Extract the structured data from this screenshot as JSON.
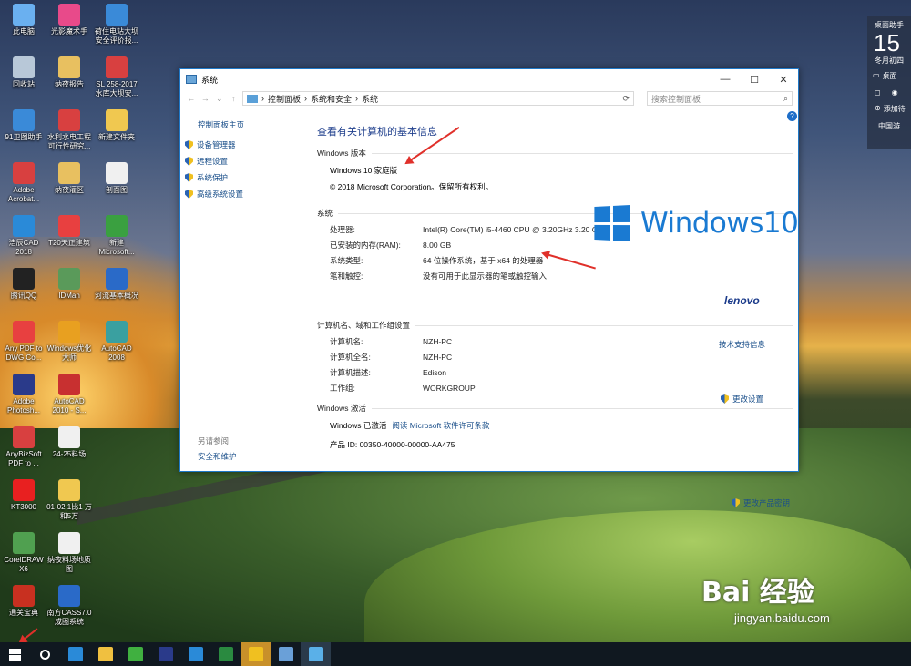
{
  "desktop_icons": [
    {
      "label": "此电脑",
      "color": "#6ab0f0"
    },
    {
      "label": "光影魔术手",
      "color": "#e84a8a"
    },
    {
      "label": "荷住电站大坝安全评价报...",
      "color": "#3a8ad8"
    },
    {
      "label": "回收站",
      "color": "#b8c8d8"
    },
    {
      "label": "纳夜报告",
      "color": "#e8c060"
    },
    {
      "label": "SL 258-2017 水库大坝安...",
      "color": "#d84040"
    },
    {
      "label": "91卫图助手",
      "color": "#3a8ad8"
    },
    {
      "label": "水利水电工程可行性研究...",
      "color": "#d84040"
    },
    {
      "label": "新建文件夹",
      "color": "#f0c850"
    },
    {
      "label": "Adobe Acrobat...",
      "color": "#d84040"
    },
    {
      "label": "纳夜灌区",
      "color": "#e8c060"
    },
    {
      "label": "剖面图",
      "color": "#f0f0f0"
    },
    {
      "label": "浩辰CAD 2018",
      "color": "#2a8ad8"
    },
    {
      "label": "T20天正建筑",
      "color": "#e84040"
    },
    {
      "label": "新建 Microsoft...",
      "color": "#3aa040"
    },
    {
      "label": "腾讯QQ",
      "color": "#222"
    },
    {
      "label": "IDMan",
      "color": "#5a9a5a"
    },
    {
      "label": "河流基本概况",
      "color": "#2a6ac8"
    },
    {
      "label": "Any PDF to DWG Co...",
      "color": "#e84040"
    },
    {
      "label": "Windows优化大师",
      "color": "#e8a020"
    },
    {
      "label": "AutoCAD 2008",
      "color": "#3aa0a0"
    },
    {
      "label": "Adobe Photosh...",
      "color": "#2a3a8a"
    },
    {
      "label": "AutoCAD 2010 - S...",
      "color": "#c83030"
    },
    {
      "label": "AnyBizSoft PDF to ...",
      "color": "#d84040"
    },
    {
      "label": "24-25料场",
      "color": "#f0f0f0"
    },
    {
      "label": "KT3000",
      "color": "#e82020"
    },
    {
      "label": "01-02 1比1 万和5万",
      "color": "#f0c850"
    },
    {
      "label": "CorelDRAW X6",
      "color": "#50a050"
    },
    {
      "label": "纳夜料场地质图",
      "color": "#f0f0f0"
    },
    {
      "label": "通关宝典",
      "color": "#c83020"
    },
    {
      "label": "南方CASS7.0 成图系统",
      "color": "#2a6ac8"
    }
  ],
  "window": {
    "title": "系统",
    "controls": {
      "minimize": "—",
      "maximize": "☐",
      "close": "✕"
    },
    "breadcrumb": [
      "控制面板",
      "系统和安全",
      "系统"
    ],
    "search_placeholder": "搜索控制面板",
    "left": {
      "home": "控制面板主页",
      "tasks": [
        "设备管理器",
        "远程设置",
        "系统保护",
        "高级系统设置"
      ],
      "see_also": "另请参阅",
      "security": "安全和维护"
    },
    "heading": "查看有关计算机的基本信息",
    "edition_header": "Windows 版本",
    "edition": "Windows 10 家庭版",
    "copyright": "© 2018 Microsoft Corporation。保留所有权利。",
    "logo_text": "Windows10",
    "system_header": "系统",
    "system_rows": [
      {
        "k": "处理器:",
        "v": "Intel(R) Core(TM) i5-4460  CPU @ 3.20GHz   3.20 GHz"
      },
      {
        "k": "已安装的内存(RAM):",
        "v": "8.00 GB"
      },
      {
        "k": "系统类型:",
        "v": "64 位操作系统，基于 x64 的处理器"
      },
      {
        "k": "笔和触控:",
        "v": "没有可用于此显示器的笔或触控输入"
      }
    ],
    "oem": "lenovo",
    "support_link": "技术支持信息",
    "computer_header": "计算机名、域和工作组设置",
    "change_settings": "更改设置",
    "computer_rows": [
      {
        "k": "计算机名:",
        "v": "NZH-PC"
      },
      {
        "k": "计算机全名:",
        "v": "NZH-PC"
      },
      {
        "k": "计算机描述:",
        "v": "Edison"
      },
      {
        "k": "工作组:",
        "v": "WORKGROUP"
      }
    ],
    "activation_header": "Windows 激活",
    "activated": "Windows 已激活",
    "license_link": "阅读 Microsoft 软件许可条款",
    "product_id": "产品 ID: 00350-40000-00000-AA475",
    "change_key": "更改产品密钥"
  },
  "widget": {
    "title": "桌面助手",
    "day": "15",
    "lunar": "冬月初四",
    "desktop": "桌面",
    "add": "添加待",
    "china": "中国游"
  },
  "taskbar_icons": [
    {
      "name": "start",
      "color": "#ffffff"
    },
    {
      "name": "cortana",
      "color": "#ffffff"
    },
    {
      "name": "edge",
      "color": "#2a8ad8"
    },
    {
      "name": "explorer",
      "color": "#f0c040"
    },
    {
      "name": "360",
      "color": "#40b040"
    },
    {
      "name": "photoshop",
      "color": "#2a3a8a"
    },
    {
      "name": "gstarcad",
      "color": "#2a8ad8"
    },
    {
      "name": "excel",
      "color": "#2a8a40"
    },
    {
      "name": "smiley",
      "color": "#f0c020"
    },
    {
      "name": "image",
      "color": "#6aa0d8"
    },
    {
      "name": "system",
      "color": "#5ab0e8"
    }
  ],
  "watermark": {
    "text": "Bai 经验",
    "url": "jingyan.baidu.com"
  }
}
